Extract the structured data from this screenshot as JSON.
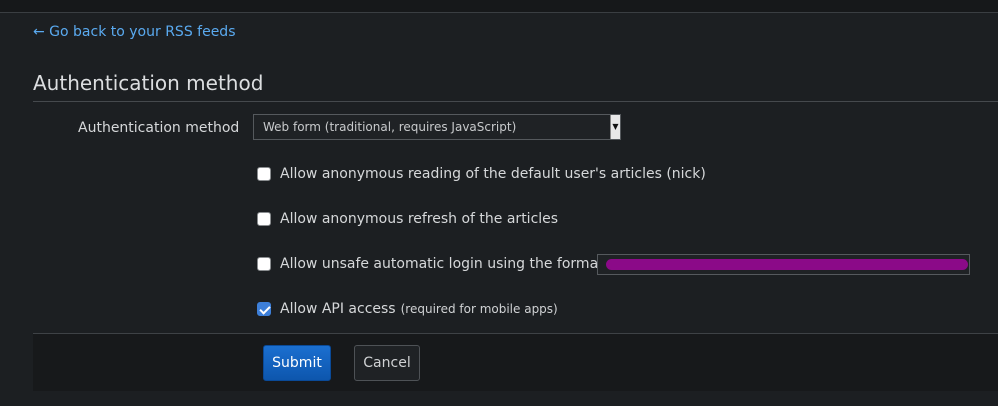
{
  "nav": {
    "back_link": "← Go back to your RSS feeds"
  },
  "section": {
    "title": "Authentication method"
  },
  "auth_method": {
    "label": "Authentication method",
    "selected": "Web form (traditional, requires JavaScript)"
  },
  "options": {
    "anonymous_reading": {
      "label": "Allow anonymous reading of the default user's articles (nick)",
      "checked": false
    },
    "anonymous_refresh": {
      "label": "Allow anonymous refresh of the articles",
      "checked": false
    },
    "unsafe_login": {
      "label": "Allow unsafe automatic login using the format:",
      "checked": false,
      "format_value_redacted": true
    },
    "api_access": {
      "label": "Allow API access",
      "note": "(required for mobile apps)",
      "checked": true
    }
  },
  "actions": {
    "submit_label": "Submit",
    "cancel_label": "Cancel"
  },
  "colors": {
    "link": "#5aaaf0",
    "primary_button": "#1b6fd0",
    "checkbox_checked": "#3d7fd9",
    "redaction": "#8b0a88"
  }
}
